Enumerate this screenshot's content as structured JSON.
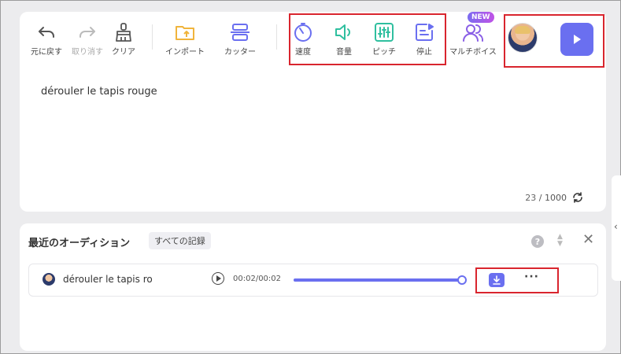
{
  "toolbar": {
    "undo": "元に戻す",
    "redo": "取り消す",
    "clear": "クリア",
    "import": "インポート",
    "cutter": "カッター",
    "speed": "速度",
    "volume": "音量",
    "pitch": "ピッチ",
    "pause": "停止",
    "multivoice": "マルチボイス",
    "new_badge": "NEW"
  },
  "editor": {
    "text": "dérouler le tapis rouge",
    "char_count": "23",
    "char_max": "/ 1000"
  },
  "audition": {
    "title": "最近のオーディション",
    "all_records": "すべての記録",
    "help": "?",
    "close": "✕",
    "rows": [
      {
        "title": "dérouler le tapis ro",
        "time": "00:02/00:02",
        "progress": 1.0,
        "more": "···"
      }
    ]
  },
  "colors": {
    "accent": "#6a6ff0",
    "gold": "#f0b43c",
    "green": "#2fbf9f",
    "highlight": "#d9252e"
  }
}
